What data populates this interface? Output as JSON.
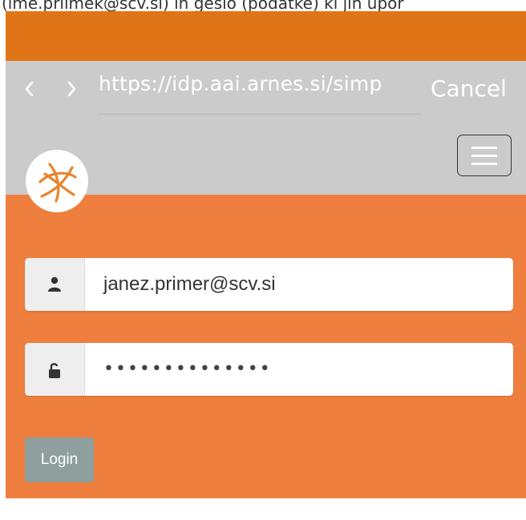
{
  "top_cut_text": "(ime.priimek@scv.si) in geslo (podatke) ki jih upor",
  "browser": {
    "back_icon": "chevron-left-icon",
    "forward_icon": "chevron-right-icon",
    "url": "https://idp.aai.arnes.si/simp",
    "cancel_label": "Cancel"
  },
  "header": {
    "logo_icon": "arnes-logo-icon",
    "menu_icon": "hamburger-menu-icon"
  },
  "login_form": {
    "username_icon": "user-icon",
    "username_value": "janez.primer@scv.si",
    "password_icon": "unlock-icon",
    "password_value": "••••••••••••••",
    "login_label": "Login"
  },
  "colors": {
    "status_bar": "#e07517",
    "browser_bar": "#cbcbcb",
    "content_bg": "#ef7f3e",
    "login_button": "#8f9f9d"
  }
}
